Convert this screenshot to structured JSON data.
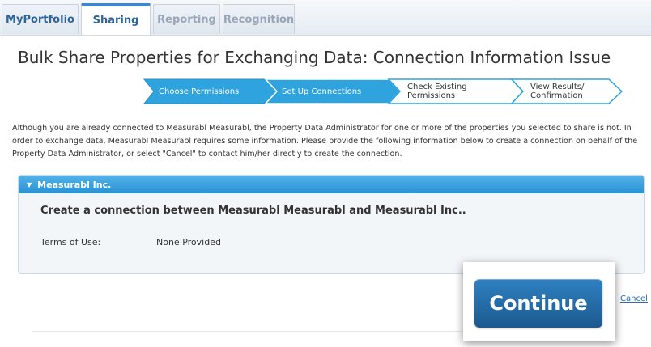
{
  "tabs": [
    {
      "label": "MyPortfolio"
    },
    {
      "label": "Sharing"
    },
    {
      "label": "Reporting"
    },
    {
      "label": "Recognition"
    }
  ],
  "active_tab": "Sharing",
  "page_title": "Bulk Share Properties for Exchanging Data: Connection Information Issue",
  "steps": [
    {
      "line1": "Choose Permissions",
      "line2": "",
      "status": "done"
    },
    {
      "line1": "Set Up Connections",
      "line2": "",
      "status": "done"
    },
    {
      "line1": "Check Existing",
      "line2": "Permissions",
      "status": "todo"
    },
    {
      "line1": "View Results/",
      "line2": "Confirmation",
      "status": "todo"
    }
  ],
  "intro_text": "Although you are already connected to Measurabl Measurabl, the Property Data Administrator for one or more of the properties you selected to share is not. In order to exchange data, Measurabl Measurabl requires some information. Please provide the following information below to create a connection on behalf of the Property Data Administrator, or select \"Cancel\" to contact him/her directly to create the connection.",
  "panel": {
    "header": "Measurabl Inc.",
    "heading": "Create a connection between Measurabl Measurabl and Measurabl Inc..",
    "terms_label": "Terms of Use:",
    "terms_value": "None Provided"
  },
  "actions": {
    "continue_label": "Continue",
    "cancel_label": "Cancel"
  },
  "colors": {
    "step_done": "#2ea3dd",
    "panel_header": "#3aa3e2",
    "continue_button": "#246ca9",
    "tab_accent": "#3e86c8"
  },
  "icons": {
    "collapse": "caret-down-icon"
  }
}
